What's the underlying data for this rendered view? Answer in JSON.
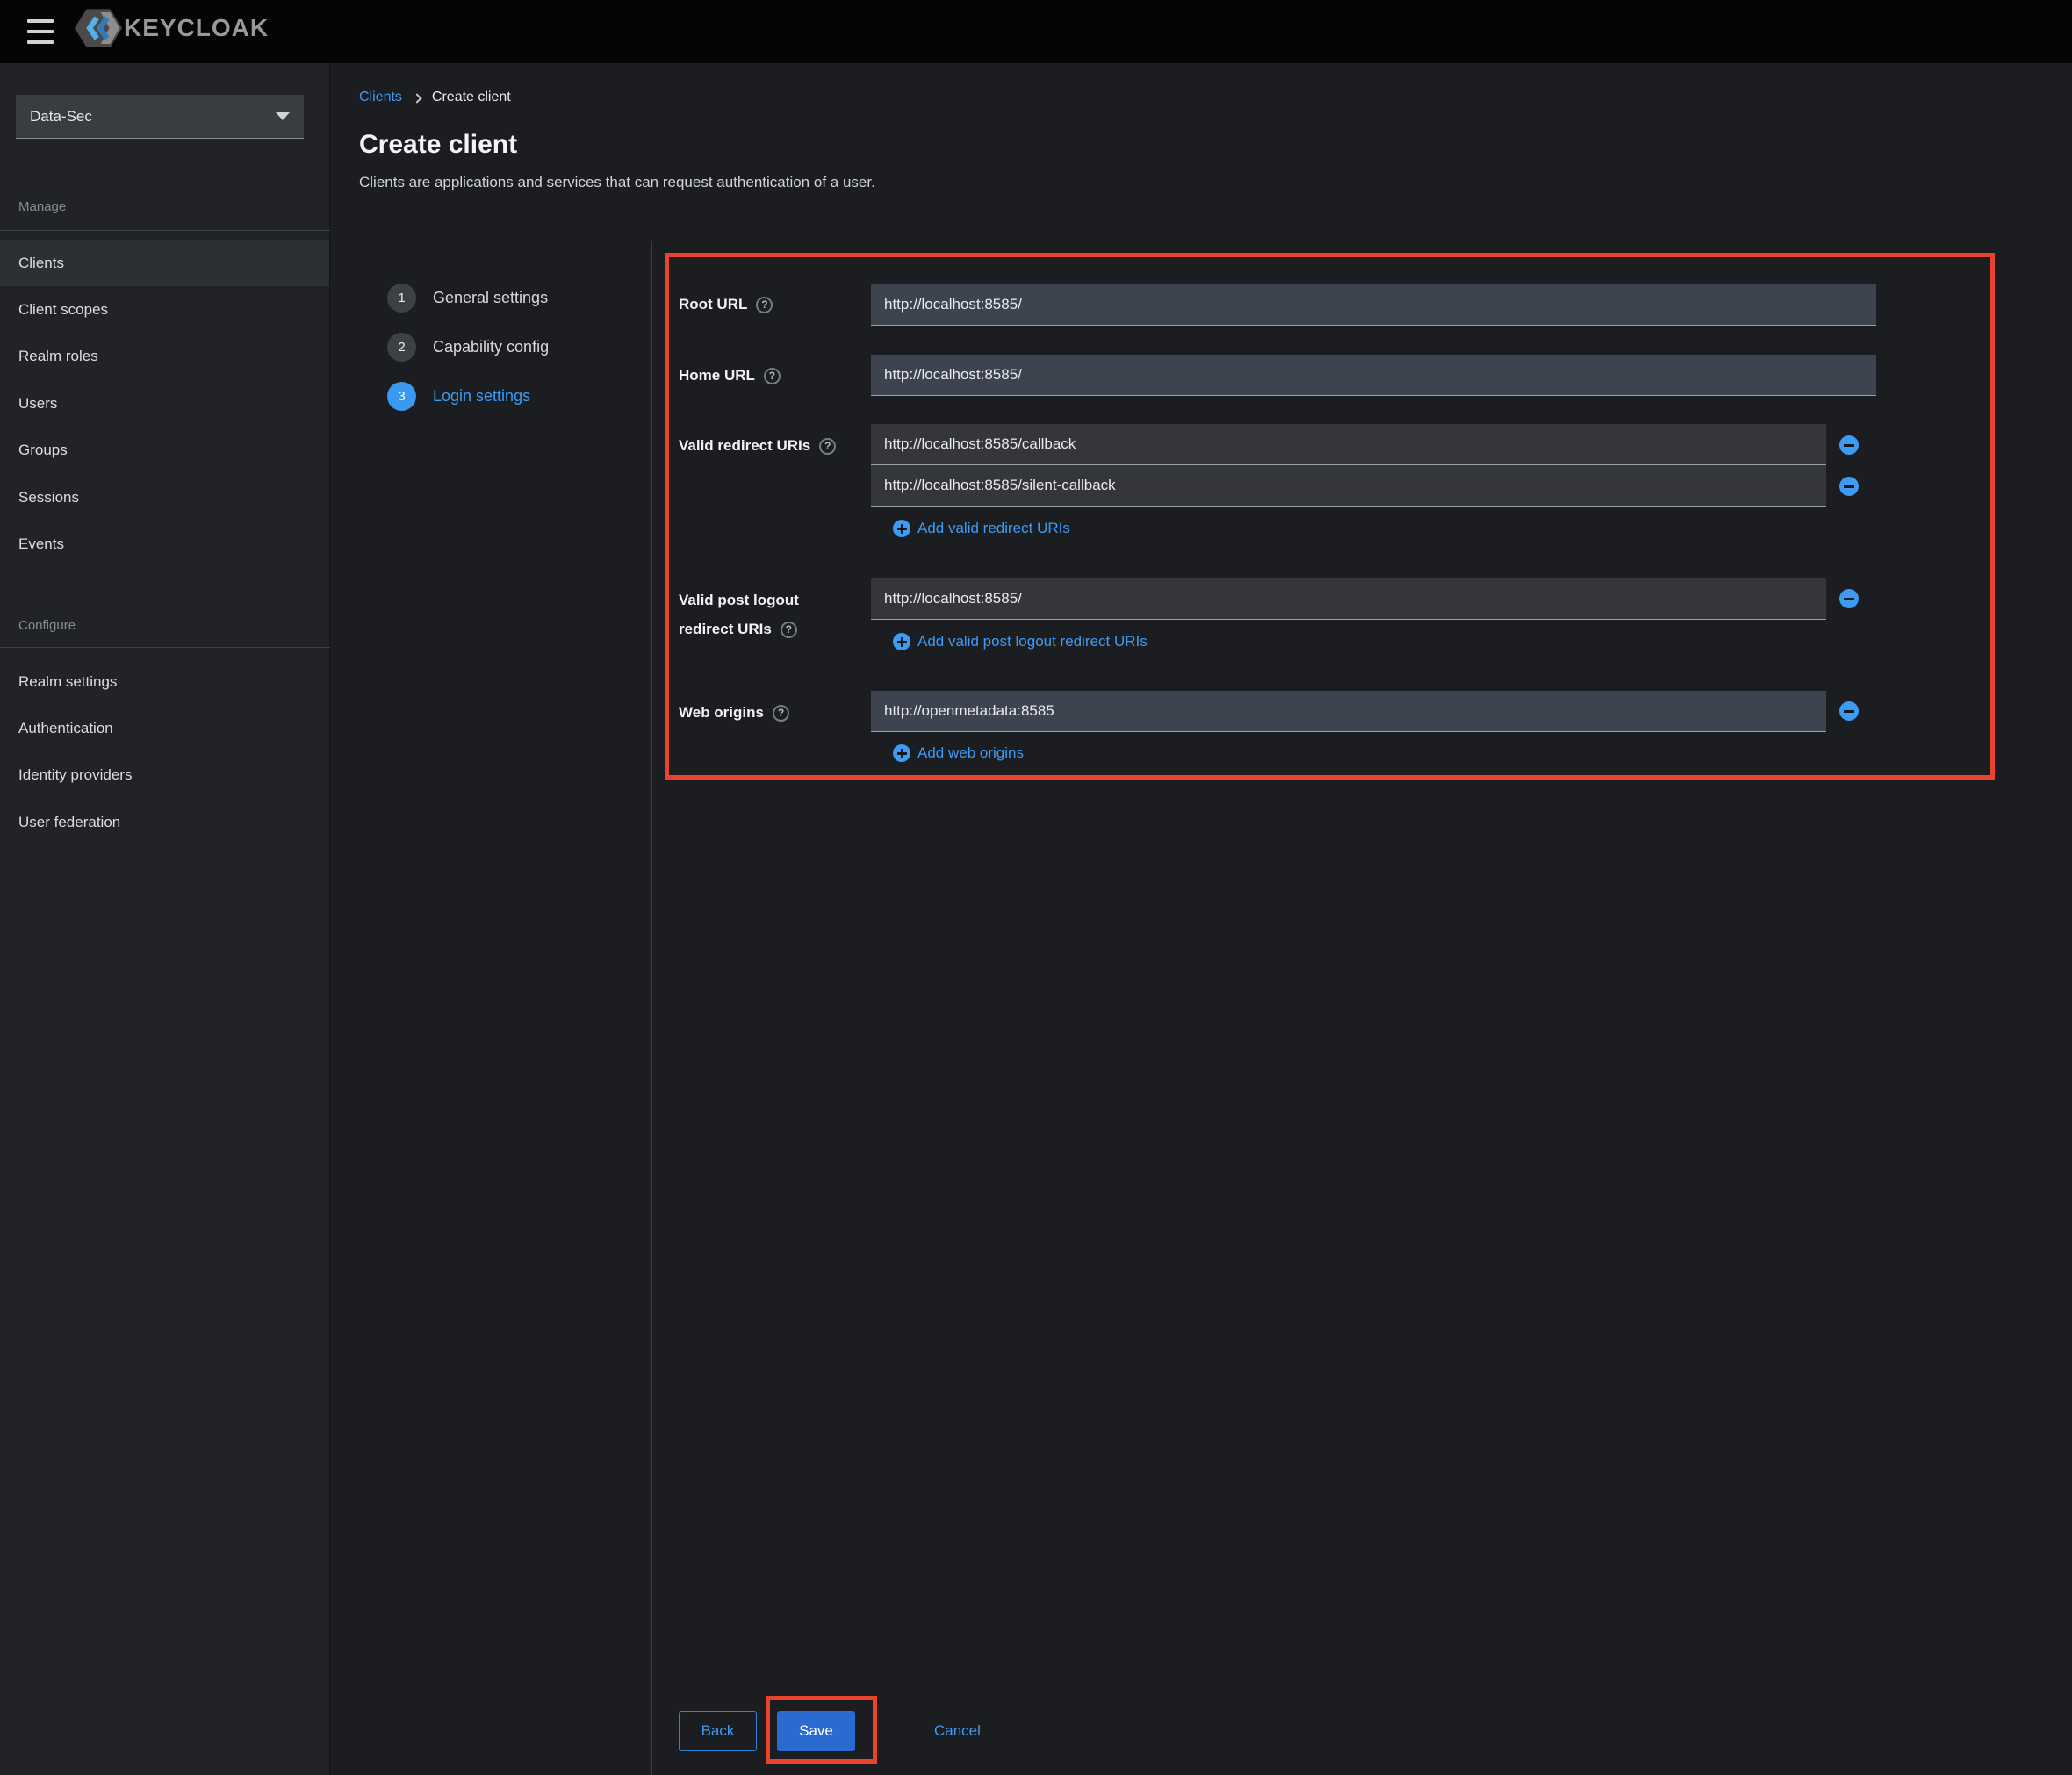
{
  "topbar": {
    "brand": "KEYCLOAK"
  },
  "sidebar": {
    "realm_selector": {
      "value": "Data-Sec"
    },
    "groups": [
      {
        "label": "Manage",
        "items": [
          "Clients",
          "Client scopes",
          "Realm roles",
          "Users",
          "Groups",
          "Sessions",
          "Events"
        ],
        "active_item": "Clients"
      },
      {
        "label": "Configure",
        "items": [
          "Realm settings",
          "Authentication",
          "Identity providers",
          "User federation"
        ]
      }
    ]
  },
  "breadcrumb": {
    "link": "Clients",
    "current": "Create client"
  },
  "page_header": {
    "title": "Create client",
    "subtitle": "Clients are applications and services that can request authentication of a user."
  },
  "wizard": {
    "steps": [
      {
        "num": "1",
        "label": "General settings",
        "state": "inactive"
      },
      {
        "num": "2",
        "label": "Capability config",
        "state": "inactive"
      },
      {
        "num": "3",
        "label": "Login settings",
        "state": "active"
      }
    ]
  },
  "form": {
    "root_url": {
      "label": "Root URL",
      "value": "http://localhost:8585/"
    },
    "home_url": {
      "label": "Home URL",
      "value": "http://localhost:8585/"
    },
    "redirect_uris": {
      "label": "Valid redirect URIs",
      "values": [
        "http://localhost:8585/callback",
        "http://localhost:8585/silent-callback"
      ],
      "add_label": "Add valid redirect URIs"
    },
    "post_logout_uris": {
      "label_line1": "Valid post logout",
      "label_line2": "redirect URIs",
      "values": [
        "http://localhost:8585/"
      ],
      "add_label": "Add valid post logout redirect URIs"
    },
    "web_origins": {
      "label": "Web origins",
      "values": [
        "http://openmetadata:8585"
      ],
      "add_label": "Add web origins"
    }
  },
  "actions": {
    "back": "Back",
    "save": "Save",
    "cancel": "Cancel"
  },
  "colors": {
    "accent_blue": "#3e9bf4",
    "save_button_blue": "#2b6bd0",
    "annotation_red": "#e8432b"
  }
}
